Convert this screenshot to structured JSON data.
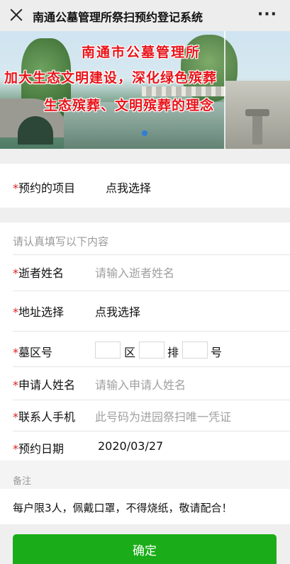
{
  "header": {
    "title": "南通公墓管理所祭扫预约登记系统",
    "more_label": "···"
  },
  "banner": {
    "line1": "南通市公墓管理所",
    "line2": "加大生态文明建设，深化绿色殡葬",
    "line3": "生态殡葬、文明殡葬的理念"
  },
  "project": {
    "label": "预约的项目",
    "value": "点我选择"
  },
  "form": {
    "header": "请认真填写以下内容",
    "deceased_name": {
      "label": "逝者姓名",
      "placeholder": "请输入逝者姓名"
    },
    "address": {
      "label": "地址选择",
      "value": "点我选择"
    },
    "grave": {
      "label": "墓区号",
      "unit_area": "区",
      "unit_row": "排",
      "unit_no": "号"
    },
    "applicant": {
      "label": "申请人姓名",
      "placeholder": "请输入申请人姓名"
    },
    "phone": {
      "label": "联系人手机",
      "placeholder": "此号码为进园祭扫唯一凭证"
    },
    "date": {
      "label": "预约日期",
      "value": "2020/03/27"
    }
  },
  "remark": {
    "title": "备注",
    "text": "每户限3人，佩戴口罩，不得烧纸，敬请配合！"
  },
  "confirm_label": "确定",
  "colors": {
    "primary": "#1aad19",
    "required": "#e02020",
    "banner_text": "#e8141a"
  }
}
